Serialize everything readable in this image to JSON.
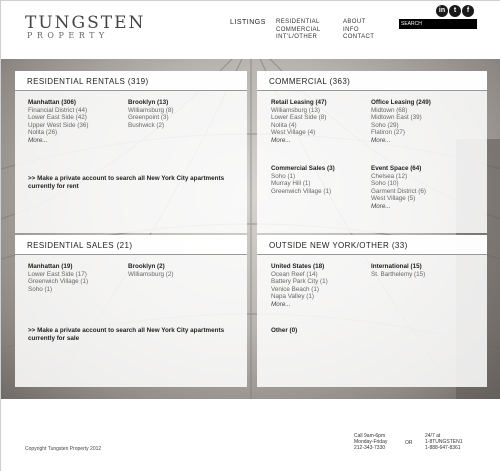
{
  "brand": {
    "name": "TUNGSTEN",
    "sub": "PROPERTY"
  },
  "nav": {
    "listings": "LISTINGS",
    "col1": [
      "RESIDENTIAL",
      "COMMERCIAL",
      "INT'L/OTHER"
    ],
    "col2": [
      "ABOUT",
      "INFO",
      "CONTACT"
    ],
    "search_placeholder": "SEARCH"
  },
  "social": [
    "in",
    "t",
    "f"
  ],
  "residential_rentals": {
    "title": "RESIDENTIAL RENTALS (319)",
    "manhattan": {
      "heading": "Manhattan (306)",
      "items": [
        "Financial District (44)",
        "Lower East Side (42)",
        "Upper West Side (36)",
        "Nolita (26)"
      ],
      "more": "More..."
    },
    "brooklyn": {
      "heading": "Brooklyn (13)",
      "items": [
        "Williamsburg (8)",
        "Greenpoint (3)",
        "Bushwick (2)"
      ]
    },
    "cta": ">> Make a private account to search all New York City apartments currently for rent"
  },
  "commercial": {
    "title": "COMMERCIAL (363)",
    "retail": {
      "heading": "Retail Leasing (47)",
      "items": [
        "Williamsburg (13)",
        "Lower East Side (8)",
        "Nolita (4)",
        "West Village (4)"
      ],
      "more": "More..."
    },
    "office": {
      "heading": "Office Leasing (249)",
      "items": [
        "Midtown (68)",
        "Midtown East (39)",
        "Soho (29)",
        "Flatiron (27)"
      ],
      "more": "More..."
    },
    "sales": {
      "heading": "Commercial Sales (3)",
      "items": [
        "Soho (1)",
        "Murray Hill (1)",
        "Greenwich Village (1)"
      ]
    },
    "event": {
      "heading": "Event Space (64)",
      "items": [
        "Chelsea (12)",
        "Soho (10)",
        "Garment District (6)",
        "West Village (5)"
      ],
      "more": "More..."
    }
  },
  "residential_sales": {
    "title": "RESIDENTIAL SALES (21)",
    "manhattan": {
      "heading": "Manhattan (19)",
      "items": [
        "Lower East Side (17)",
        "Greenwich Village (1)",
        "Soho (1)"
      ]
    },
    "brooklyn": {
      "heading": "Brooklyn (2)",
      "items": [
        "Williamsburg (2)"
      ]
    },
    "cta": ">> Make a private account to search all New York City apartments currently for sale"
  },
  "outside": {
    "title": "OUTSIDE NEW YORK/OTHER (33)",
    "us": {
      "heading": "United States (18)",
      "items": [
        "Ocean Reef (14)",
        "Battery Park City (1)",
        "Venice Beach (1)",
        "Napa Valley (1)"
      ],
      "more": "More..."
    },
    "intl": {
      "heading": "International (15)",
      "items": [
        "St. Barthelemy (15)"
      ]
    },
    "other": {
      "heading": "Other (0)"
    }
  },
  "footer": {
    "copyright": "Copyright Tungsten Property 2012",
    "call": [
      "Call 9am-6pm",
      "Monday-Friday",
      "212-343-7330"
    ],
    "or": "OR",
    "alt": [
      "24/7 at",
      "1-8TUNGSTEN1",
      "1-888-647-8361"
    ]
  }
}
